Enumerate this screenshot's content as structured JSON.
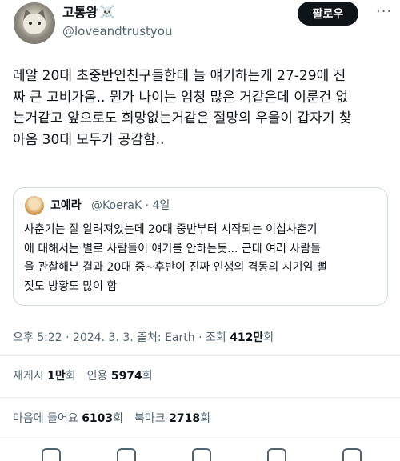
{
  "author": {
    "name": "고통왕",
    "badge_glyph": "☠️",
    "handle": "@loveandtrustyou"
  },
  "follow_label": "팔로우",
  "more_glyph": "···",
  "tweet_lines": [
    "레알 20대 초중반인친구들한테 늘 얘기하는게 27-29에 진",
    "짜 큰 고비가옴.. 뭔가 나이는 엄청 많은 거같은데 이룬건 없",
    "는거같고 앞으로도 희망없는거같은 절망의 우울이 갑자기 찾",
    "아옴 30대 모두가 공감함.."
  ],
  "quote": {
    "name": "고예라",
    "handle_time": "@KoeraK · 4일",
    "lines": [
      "사춘기는 잘 알려져있는데 20대 중반부터 시작되는 이십사춘기",
      "에 대해서는 별로 사람들이 얘기를 안하는듯... 근데 여러 사람들",
      "을 관찰해본 결과 20대 중~후반이 진짜 인생의 격동의 시기임 뻘",
      "짓도 방황도 많이 함"
    ]
  },
  "meta": {
    "time_date_source": "오후 5:22 · 2024. 3. 3. 출처: Earth · 조회 ",
    "views": "412만",
    "views_suffix": "회"
  },
  "stats": {
    "retweets_label": "재게시 ",
    "retweets": "1만",
    "retweets_suffix": "회",
    "quotes_label": "인용 ",
    "quotes": "5974",
    "quotes_suffix": "회",
    "likes_label": "마음에 들어요 ",
    "likes": "6103",
    "likes_suffix": "회",
    "bookmarks_label": "북마크 ",
    "bookmarks": "2718",
    "bookmarks_suffix": "회"
  },
  "colors": {
    "text": "#0f1419",
    "secondary": "#536471",
    "border": "#cfd9de",
    "button_bg": "#0f1419"
  }
}
